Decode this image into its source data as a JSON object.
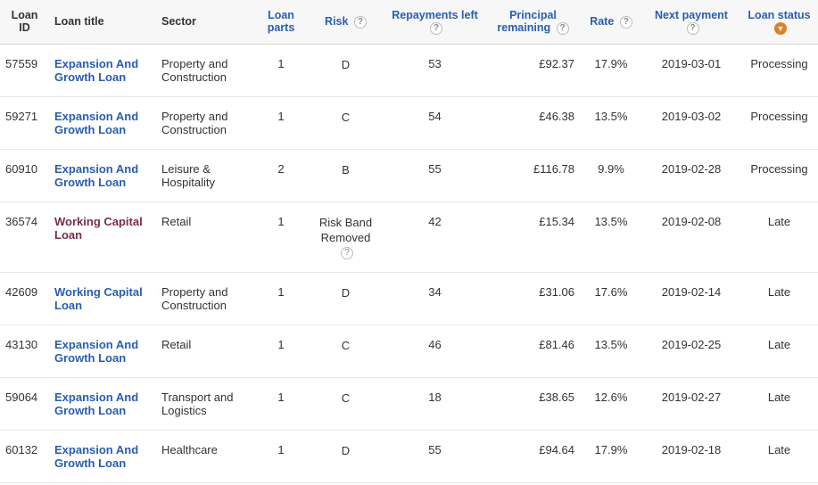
{
  "headers": {
    "loan_id": "Loan ID",
    "loan_title": "Loan title",
    "sector": "Sector",
    "loan_parts": "Loan parts",
    "risk": "Risk",
    "repayments_left": "Repayments left",
    "principal_remaining": "Principal remaining",
    "rate": "Rate",
    "next_payment": "Next payment",
    "loan_status": "Loan status"
  },
  "rows": [
    {
      "id": "57559",
      "title": "Expansion And Growth Loan",
      "title_style": "blue",
      "sector": "Property and Construction",
      "parts": "1",
      "risk": "D",
      "risk_help": false,
      "repayments": "53",
      "principal": "£92.37",
      "rate": "17.9%",
      "next": "2019-03-01",
      "status": "Processing"
    },
    {
      "id": "59271",
      "title": "Expansion And Growth Loan",
      "title_style": "blue",
      "sector": "Property and Construction",
      "parts": "1",
      "risk": "C",
      "risk_help": false,
      "repayments": "54",
      "principal": "£46.38",
      "rate": "13.5%",
      "next": "2019-03-02",
      "status": "Processing"
    },
    {
      "id": "60910",
      "title": "Expansion And Growth Loan",
      "title_style": "blue",
      "sector": "Leisure & Hospitality",
      "parts": "2",
      "risk": "B",
      "risk_help": false,
      "repayments": "55",
      "principal": "£116.78",
      "rate": "9.9%",
      "next": "2019-02-28",
      "status": "Processing"
    },
    {
      "id": "36574",
      "title": "Working Capital Loan",
      "title_style": "maroon",
      "sector": "Retail",
      "parts": "1",
      "risk": "Risk Band Removed",
      "risk_help": true,
      "repayments": "42",
      "principal": "£15.34",
      "rate": "13.5%",
      "next": "2019-02-08",
      "status": "Late"
    },
    {
      "id": "42609",
      "title": "Working Capital Loan",
      "title_style": "blue",
      "sector": "Property and Construction",
      "parts": "1",
      "risk": "D",
      "risk_help": false,
      "repayments": "34",
      "principal": "£31.06",
      "rate": "17.6%",
      "next": "2019-02-14",
      "status": "Late"
    },
    {
      "id": "43130",
      "title": "Expansion And Growth Loan",
      "title_style": "blue",
      "sector": "Retail",
      "parts": "1",
      "risk": "C",
      "risk_help": false,
      "repayments": "46",
      "principal": "£81.46",
      "rate": "13.5%",
      "next": "2019-02-25",
      "status": "Late"
    },
    {
      "id": "59064",
      "title": "Expansion And Growth Loan",
      "title_style": "blue",
      "sector": "Transport and Logistics",
      "parts": "1",
      "risk": "C",
      "risk_help": false,
      "repayments": "18",
      "principal": "£38.65",
      "rate": "12.6%",
      "next": "2019-02-27",
      "status": "Late"
    },
    {
      "id": "60132",
      "title": "Expansion And Growth Loan",
      "title_style": "blue",
      "sector": "Healthcare",
      "parts": "1",
      "risk": "D",
      "risk_help": false,
      "repayments": "55",
      "principal": "£94.64",
      "rate": "17.9%",
      "next": "2019-02-18",
      "status": "Late"
    }
  ]
}
